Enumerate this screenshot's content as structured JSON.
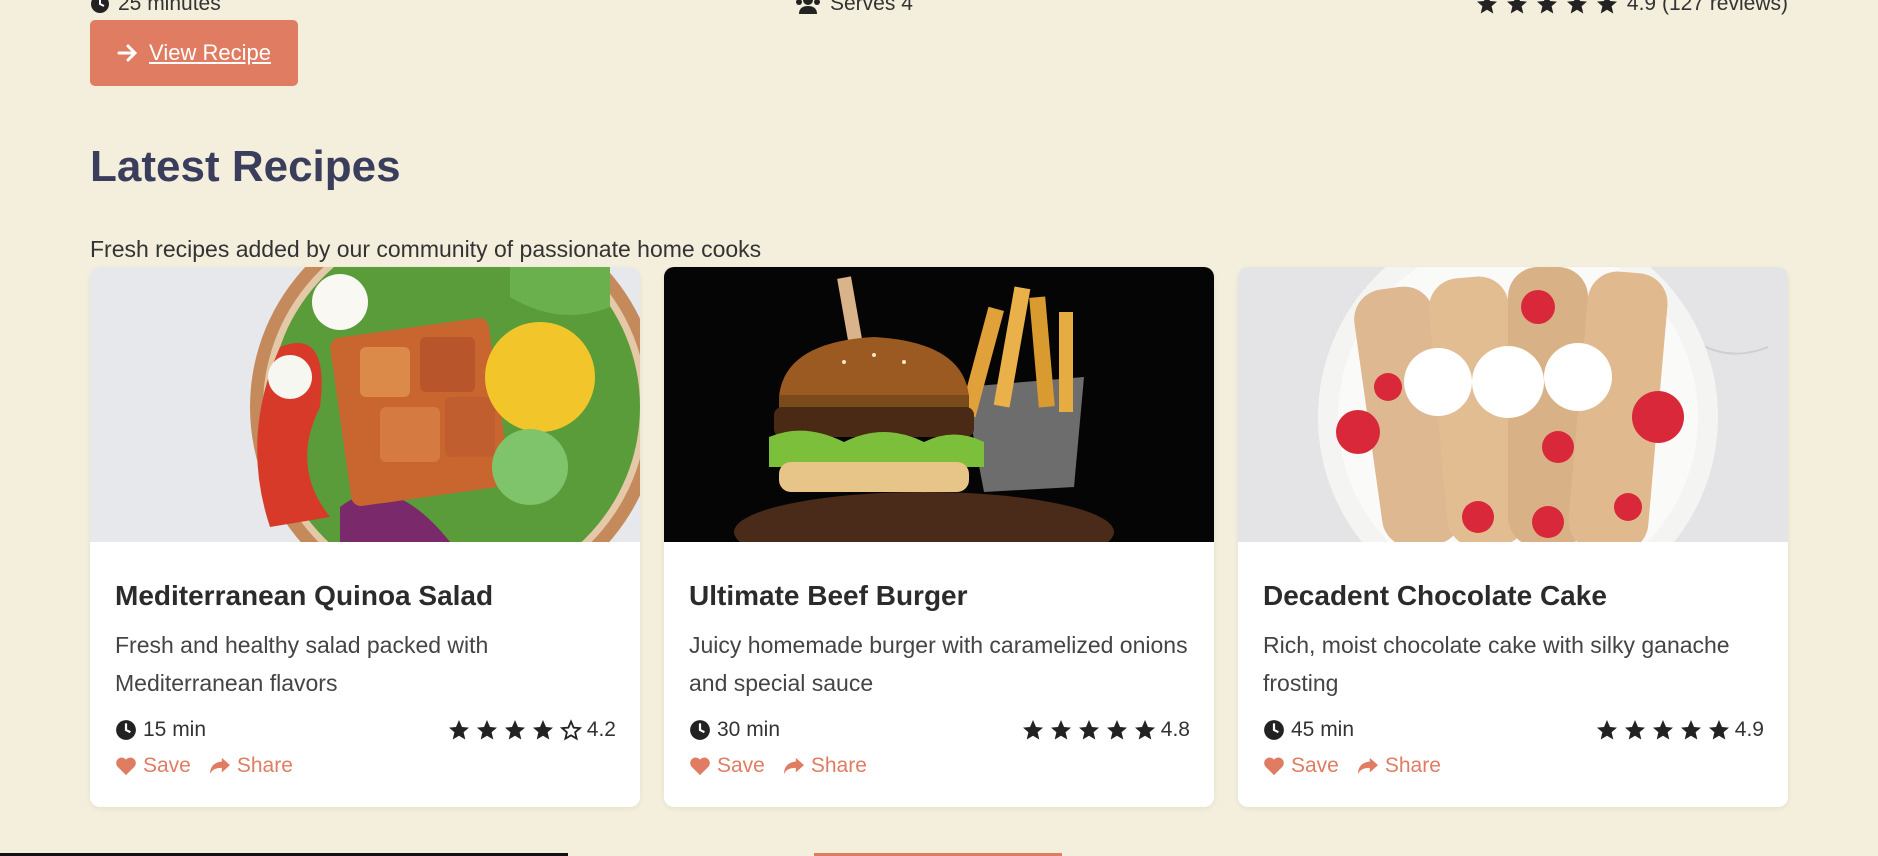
{
  "top_meta": {
    "time": "25 minutes",
    "serves": "Serves 4",
    "rating_text": "4.9 (127 reviews)"
  },
  "view_button": {
    "label": "View Recipe"
  },
  "section": {
    "title": "Latest Recipes",
    "subtitle": "Fresh recipes added by our community of passionate home cooks"
  },
  "cards": [
    {
      "title": "Mediterranean Quinoa Salad",
      "description": "Fresh and healthy salad packed with Mediterranean flavors",
      "time": "15 min",
      "rating": "4.2",
      "stars_filled": 4,
      "save": "Save",
      "share": "Share"
    },
    {
      "title": "Ultimate Beef Burger",
      "description": "Juicy homemade burger with caramelized onions and special sauce",
      "time": "30 min",
      "rating": "4.8",
      "stars_filled": 5,
      "save": "Save",
      "share": "Share"
    },
    {
      "title": "Decadent Chocolate Cake",
      "description": "Rich, moist chocolate cake with silky ganache frosting",
      "time": "45 min",
      "rating": "4.9",
      "stars_filled": 5,
      "save": "Save",
      "share": "Share"
    }
  ],
  "colors": {
    "background": "#f3efdc",
    "accent": "#e07c62",
    "heading": "#3b3d5c"
  }
}
